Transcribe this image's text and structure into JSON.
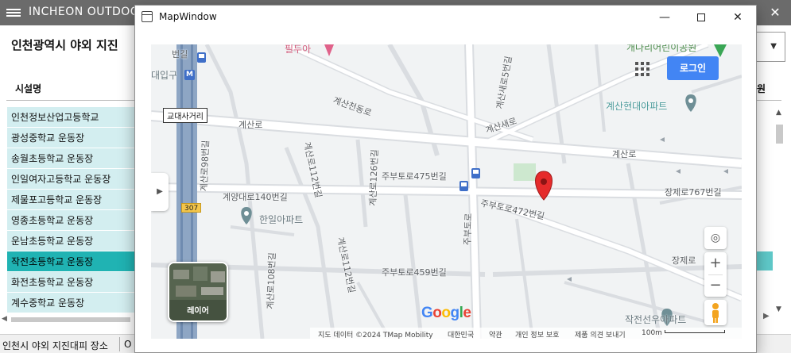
{
  "background_app": {
    "title": "INCHEON OUTDOO",
    "heading": "인천광역시 야외 지진",
    "column_header": "시설명",
    "column_header_right": "원",
    "rows": [
      "인천정보산업고등학교",
      "광성중학교 운동장",
      "송월초등학교 운동장",
      "인일여자고등학교 운동장",
      "제물포고등학교 운동장",
      "영종초등학교 운동장",
      "운남초등학교 운동장",
      "작전초등학교 운동장",
      "화전초등학교 운동장",
      "계수중학교 운동장"
    ],
    "selected_row_index": 7,
    "status_text": "인천시 야외 지진대피 장소",
    "status_text_2": "O",
    "close_glyph": "✕"
  },
  "map_window": {
    "title": "MapWindow",
    "controls": {
      "minimize": "—",
      "close": "✕"
    },
    "map": {
      "login_label": "로그인",
      "layer_label": "레이어",
      "google_logo": [
        "G",
        "o",
        "o",
        "g",
        "l",
        "e"
      ],
      "google_colors": [
        "#4285f4",
        "#ea4335",
        "#fbbc05",
        "#4285f4",
        "#34a853",
        "#ea4335"
      ],
      "road_labels": {
        "gyesan_ro_top": "계산로",
        "gyesan_ro_right": "계산로",
        "gyesancheondong_ro": "계산천동로",
        "gyesanse_ro": "계산새로",
        "gyesan_5_beon": "계산새로5번길",
        "gyesan_98": "계산로98번길",
        "gyesan_112": "계산로112번길",
        "gyesan_126": "계산로126번길",
        "jubu_475": "주부토로475번길",
        "jubu_472": "주부토로472번길",
        "jubu_459": "주부토로459번길",
        "jubu_to_ro": "주부토로",
        "gyeyang_140": "계양대로140번길",
        "gyesan_112_b": "계산로112번길",
        "gyesan_108": "계산로108번길",
        "jangje_767": "장제로767번길",
        "jangje": "장제로",
        "beongil_top": "번길"
      },
      "poi_labels": {
        "gyesan_hyundai": "계산현대아파트",
        "hanil": "한일아파트",
        "jakjeon_sunwoo": "작전선우아파트",
        "daeipgu": "대입구",
        "top_pink": "필두아",
        "top_green": "개나리어린이공원"
      },
      "route_number": "307",
      "intersection": "교대사거리",
      "subway_glyph": "M",
      "footer": {
        "data": "지도 데이터 ©2024 TMap Mobility",
        "country": "대한민국",
        "terms": "약관",
        "privacy": "개인 정보 보호",
        "feedback": "제품 의견 보내기",
        "scale": "100m"
      }
    }
  },
  "colors": {
    "selected_row": "#20b3b3",
    "row": "#d3eef0",
    "login_button": "#4285f4",
    "marker": "#e52b2b",
    "highway": "#8ea6c4"
  }
}
